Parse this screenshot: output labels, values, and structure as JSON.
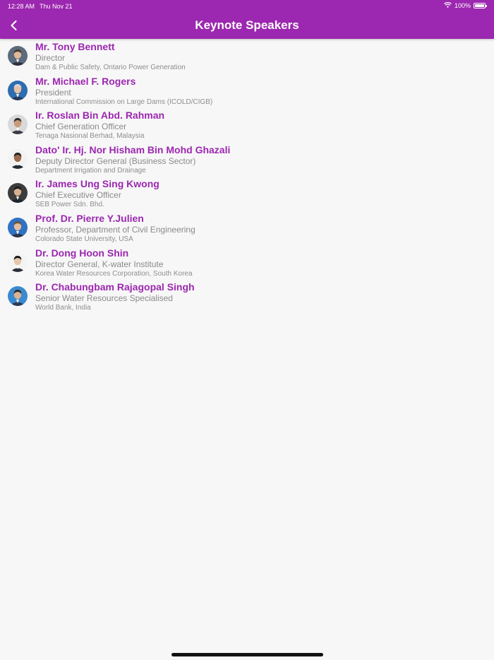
{
  "status_bar": {
    "time": "12:28 AM",
    "date": "Thu Nov 21",
    "battery": "100%",
    "battery_level": 1.0
  },
  "header": {
    "title": "Keynote Speakers",
    "back_icon": "chevron-left-icon",
    "background_color": "#9c27b0"
  },
  "colors": {
    "name": "#9c27b0",
    "role": "#8a8a8a"
  },
  "speakers": [
    {
      "name": "Mr. Tony Bennett",
      "role": "Director",
      "org": "Dam & Public Safety, Ontario Power Generation",
      "avatar_bg": "#5c6b7d",
      "avatar_skin": "#e0b89a",
      "avatar_hair": "#4a3a2e",
      "avatar_suit": "#2d3440"
    },
    {
      "name": "Mr. Michael F. Rogers",
      "role": "President",
      "org": "International Commission on Large Dams (ICOLD/CIGB)",
      "avatar_bg": "#2f6db0",
      "avatar_skin": "#e6c2a6",
      "avatar_hair": "#d7d7d7",
      "avatar_suit": "#263a5c"
    },
    {
      "name": "Ir. Roslan Bin Abd. Rahman",
      "role": "Chief Generation Officer",
      "org": "Tenaga Nasional Berhad, Malaysia",
      "avatar_bg": "#d9d9d9",
      "avatar_skin": "#c99a78",
      "avatar_hair": "#2b2b2b",
      "avatar_suit": "#3a3a44"
    },
    {
      "name": "Dato' Ir. Hj. Nor Hisham Bin Mohd Ghazali",
      "role": "Deputy Director General (Business Sector)",
      "org": "Department Irrigation and Drainage",
      "avatar_bg": "#f2f2f2",
      "avatar_skin": "#9a6a4a",
      "avatar_hair": "#1f1f1f",
      "avatar_suit": "#222a36"
    },
    {
      "name": "Ir. James Ung Sing Kwong",
      "role": "Chief Executive Officer",
      "org": "SEB Power Sdn. Bhd.",
      "avatar_bg": "#3c3c3c",
      "avatar_skin": "#d8b08e",
      "avatar_hair": "#1a1a1a",
      "avatar_suit": "#1e2530"
    },
    {
      "name": "Prof. Dr. Pierre Y.Julien",
      "role": "Professor, Department of Civil Engineering",
      "org": "Colorado State University, USA",
      "avatar_bg": "#2f72c4",
      "avatar_skin": "#e4bd9e",
      "avatar_hair": "#6b5440",
      "avatar_suit": "#2b3443"
    },
    {
      "name": "Dr. Dong Hoon Shin",
      "role": "Director General, K-water Institute",
      "org": "Korea Water Resources Corporation, South Korea",
      "avatar_bg": "#f4f4f4",
      "avatar_skin": "#e6c7aa",
      "avatar_hair": "#151515",
      "avatar_suit": "#2a2f3a"
    },
    {
      "name": "Dr. Chabungbam Rajagopal Singh",
      "role": "Senior Water Resources Specialised",
      "org": "World Bank, India",
      "avatar_bg": "#3a8ad0",
      "avatar_skin": "#d9b392",
      "avatar_hair": "#2a2a2a",
      "avatar_suit": "#2c3a52"
    }
  ]
}
